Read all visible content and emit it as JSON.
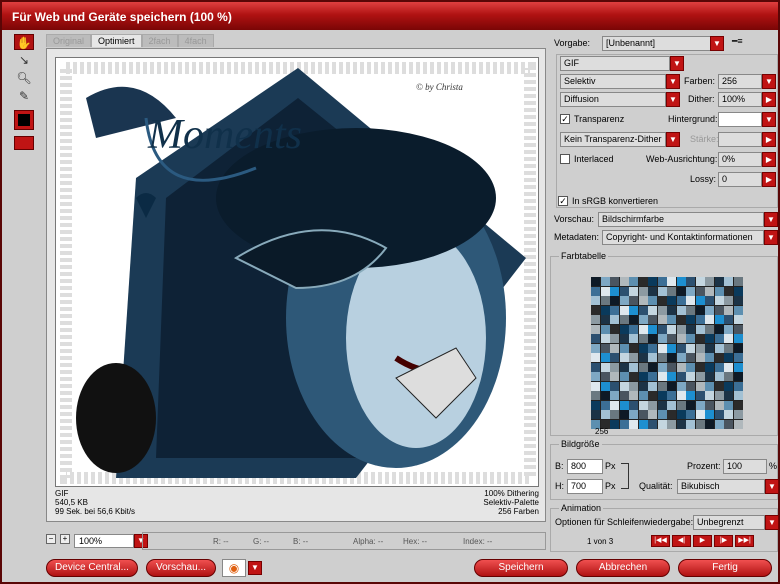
{
  "title": "Für Web und Geräte speichern (100 %)",
  "tabs": [
    "Original",
    "Optimiert",
    "2fach",
    "4fach"
  ],
  "image": {
    "signature": "© by Christa",
    "word": "Moments"
  },
  "preview_info": {
    "format": "GIF",
    "size": "540,5 KB",
    "time": "99 Sek. bei 56,6 Kbit/s",
    "dither": "100% Dithering",
    "palette": "Selektiv-Palette",
    "colors": "256 Farben"
  },
  "zoom": "100%",
  "info": {
    "r": "R: --",
    "g": "G: --",
    "b": "B: --",
    "alpha": "Alpha: --",
    "hex": "Hex: --",
    "index": "Index: --"
  },
  "settings": {
    "vorgabe_label": "Vorgabe:",
    "vorgabe": "[Unbenannt]",
    "format": "GIF",
    "reduction": "Selektiv",
    "farben_label": "Farben:",
    "farben": "256",
    "dither_algo": "Diffusion",
    "dither_label": "Dither:",
    "dither": "100%",
    "transparenz": "Transparenz",
    "hintergrund_label": "Hintergrund:",
    "trans_dither": "Kein Transparenz-Dither",
    "staerke_label": "Stärke:",
    "interlaced": "Interlaced",
    "web_label": "Web-Ausrichtung:",
    "web": "0%",
    "lossy_label": "Lossy:",
    "lossy": "0",
    "srgb": "In sRGB konvertieren",
    "vorschau_label": "Vorschau:",
    "vorschau": "Bildschirmfarbe",
    "metadaten_label": "Metadaten:",
    "metadaten": "Copyright- und Kontaktinformationen"
  },
  "farbtabelle": {
    "title": "Farbtabelle",
    "count": "256"
  },
  "bildgroesse": {
    "title": "Bildgröße",
    "b_label": "B:",
    "b": "800",
    "h_label": "H:",
    "h": "700",
    "unit": "Px",
    "prozent_label": "Prozent:",
    "prozent": "100",
    "percent_sign": "%",
    "qualitaet_label": "Qualität:",
    "qualitaet": "Bikubisch"
  },
  "animation": {
    "title": "Animation",
    "loop_label": "Optionen für Schleifenwiedergabe:",
    "loop": "Unbegrenzt",
    "frame": "1 von 3"
  },
  "buttons": {
    "device": "Device Central...",
    "vorschau": "Vorschau...",
    "speichern": "Speichern",
    "abbrechen": "Abbrechen",
    "fertig": "Fertig"
  },
  "icons": [
    "hand-icon",
    "slice-select-icon",
    "zoom-icon",
    "eyedropper-icon",
    "color-swatch-icon",
    "slice-visibility-icon",
    "firefox-icon"
  ]
}
